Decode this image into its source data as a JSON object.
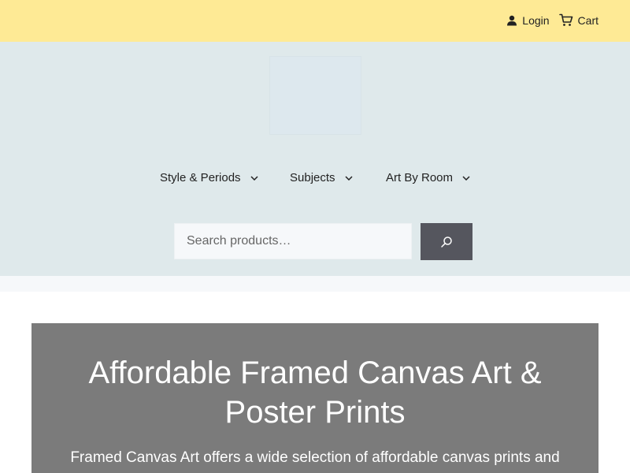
{
  "topbar": {
    "login_label": "Login",
    "cart_label": "Cart",
    "background": "#feea95"
  },
  "header": {
    "background": "#dfe9eb"
  },
  "nav": {
    "items": [
      {
        "label": "Style & Periods"
      },
      {
        "label": "Subjects"
      },
      {
        "label": "Art By Room"
      }
    ]
  },
  "search": {
    "placeholder": "Search products…",
    "button_color": "#55565e"
  },
  "hero": {
    "title": "Affordable Framed Canvas Art & Poster Prints",
    "intro": "Framed Canvas Art offers a wide selection of affordable canvas prints and",
    "background": "#7b7b7b"
  }
}
